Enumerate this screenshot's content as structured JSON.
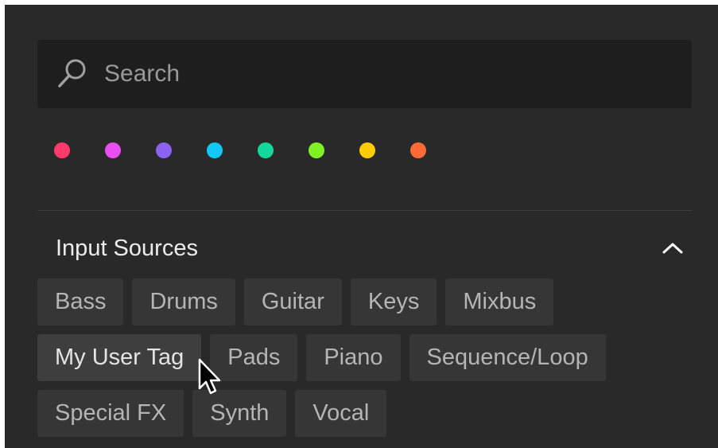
{
  "search": {
    "placeholder": "Search",
    "value": ""
  },
  "colors": [
    {
      "name": "color-dot-red",
      "hex": "#ff3b6b"
    },
    {
      "name": "color-dot-magenta",
      "hex": "#e84ff0"
    },
    {
      "name": "color-dot-purple",
      "hex": "#8a63f2"
    },
    {
      "name": "color-dot-cyan",
      "hex": "#14c8f5"
    },
    {
      "name": "color-dot-teal",
      "hex": "#14d89a"
    },
    {
      "name": "color-dot-green",
      "hex": "#7ef224"
    },
    {
      "name": "color-dot-yellow",
      "hex": "#ffcc00"
    },
    {
      "name": "color-dot-orange",
      "hex": "#ff6a35"
    }
  ],
  "section": {
    "title": "Input Sources",
    "collapse_icon": "chevron-up-icon"
  },
  "tags": [
    [
      "Bass",
      "Drums",
      "Guitar",
      "Keys",
      "Mixbus"
    ],
    [
      "My User Tag",
      "Pads",
      "Piano",
      "Sequence/Loop"
    ],
    [
      "Special FX",
      "Synth",
      "Vocal"
    ]
  ],
  "hovered_tag": "My User Tag"
}
